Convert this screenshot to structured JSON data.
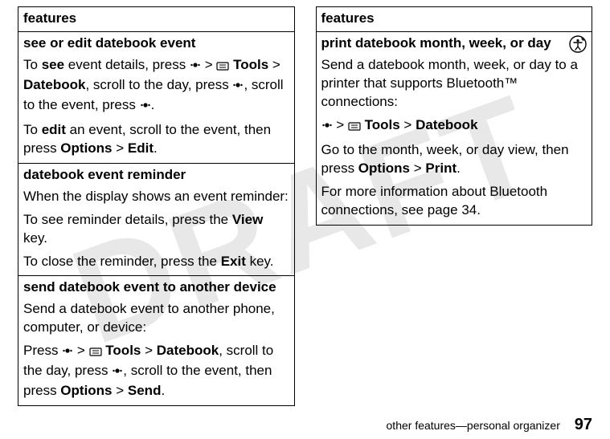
{
  "watermark": "DRAFT",
  "left": {
    "header": "features",
    "rows": [
      {
        "title": "see or edit datebook event",
        "p1_a": "To ",
        "p1_see": "see",
        "p1_b": " event details, press ",
        "p1_c": " > ",
        "p1_tools": "Tools",
        "p1_d": " > ",
        "p1_datebook": "Datebook",
        "p1_e": ", scroll to the day, press ",
        "p1_f": ", scroll to the event, press ",
        "p1_g": ".",
        "p2_a": "To ",
        "p2_edit": "edit",
        "p2_b": " an event, scroll to the event, then press ",
        "p2_options": "Options",
        "p2_c": " > ",
        "p2_editlbl": "Edit",
        "p2_d": "."
      },
      {
        "title": "datebook event reminder",
        "p1": "When the display shows an event reminder:",
        "p2_a": "To see reminder details, press the ",
        "p2_view": "View",
        "p2_b": " key.",
        "p3_a": "To close the reminder, press the ",
        "p3_exit": "Exit",
        "p3_b": " key."
      },
      {
        "title": "send datebook event to another device",
        "p1": "Send a datebook event to another phone, computer, or device:",
        "p2_a": "Press ",
        "p2_b": " > ",
        "p2_tools": "Tools",
        "p2_c": " > ",
        "p2_datebook": "Datebook",
        "p2_d": ", scroll to the day, press ",
        "p2_e": ", scroll to the event, then press ",
        "p2_options": "Options",
        "p2_f": " > ",
        "p2_send": "Send",
        "p2_g": "."
      }
    ]
  },
  "right": {
    "header": "features",
    "row": {
      "title": "print datebook month, week, or day",
      "p1": "Send a datebook month, week, or day to a printer that supports Bluetooth™ connections:",
      "p2_a": "",
      "p2_b": " > ",
      "p2_tools": "Tools",
      "p2_c": " > ",
      "p2_datebook": "Datebook",
      "p3_a": "Go to the month, week, or day view, then press ",
      "p3_options": "Options",
      "p3_b": " > ",
      "p3_print": "Print",
      "p3_c": ".",
      "p4": "For more information about Bluetooth connections, see page 34."
    }
  },
  "footer_text": "other features—personal organizer",
  "page_number": "97",
  "icons": {
    "center": "center-key-icon",
    "tools": "tools-icon",
    "access": "accessibility-icon"
  }
}
